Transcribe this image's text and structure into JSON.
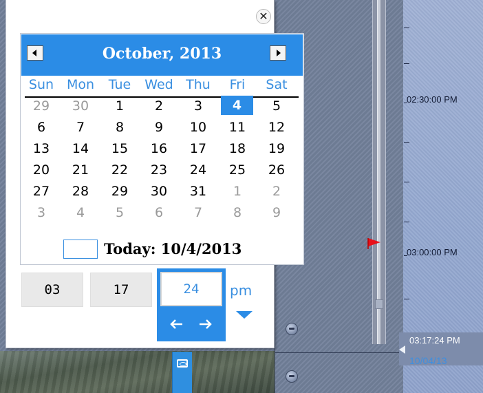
{
  "calendar": {
    "month_title": "October, 2013",
    "weekdays": [
      "Sun",
      "Mon",
      "Tue",
      "Wed",
      "Thu",
      "Fri",
      "Sat"
    ],
    "weeks": [
      [
        {
          "d": "29",
          "o": true
        },
        {
          "d": "30",
          "o": true
        },
        {
          "d": "1"
        },
        {
          "d": "2"
        },
        {
          "d": "3"
        },
        {
          "d": "4",
          "sel": true
        },
        {
          "d": "5"
        }
      ],
      [
        {
          "d": "6"
        },
        {
          "d": "7"
        },
        {
          "d": "8"
        },
        {
          "d": "9"
        },
        {
          "d": "10"
        },
        {
          "d": "11"
        },
        {
          "d": "12"
        }
      ],
      [
        {
          "d": "13"
        },
        {
          "d": "14"
        },
        {
          "d": "15"
        },
        {
          "d": "16"
        },
        {
          "d": "17"
        },
        {
          "d": "18"
        },
        {
          "d": "19"
        }
      ],
      [
        {
          "d": "20"
        },
        {
          "d": "21"
        },
        {
          "d": "22"
        },
        {
          "d": "23"
        },
        {
          "d": "24"
        },
        {
          "d": "25"
        },
        {
          "d": "26"
        }
      ],
      [
        {
          "d": "27"
        },
        {
          "d": "28"
        },
        {
          "d": "29"
        },
        {
          "d": "30"
        },
        {
          "d": "31"
        },
        {
          "d": "1",
          "o": true
        },
        {
          "d": "2",
          "o": true
        }
      ],
      [
        {
          "d": "3",
          "o": true
        },
        {
          "d": "4",
          "o": true
        },
        {
          "d": "5",
          "o": true
        },
        {
          "d": "6",
          "o": true
        },
        {
          "d": "7",
          "o": true
        },
        {
          "d": "8",
          "o": true
        },
        {
          "d": "9",
          "o": true
        }
      ]
    ],
    "today_label": "Today: 10/4/2013",
    "selected_day": "4"
  },
  "time": {
    "hours": "03",
    "minutes": "17",
    "seconds": "24",
    "ampm": "pm"
  },
  "timeline": {
    "labels": [
      "02:30:00 PM",
      "03:00:00 PM"
    ],
    "cursor_time": "03:17:24 PM",
    "cursor_date": "10/04/13"
  },
  "icons": {
    "close": "close-icon",
    "prev": "arrow-left-icon",
    "next": "arrow-right-icon",
    "camera": "camera-icon",
    "flag": "marker-flag-icon"
  },
  "colors": {
    "accent": "#2b8ce6",
    "timeline": "#9fb0d4",
    "marker": "#e8101a"
  }
}
